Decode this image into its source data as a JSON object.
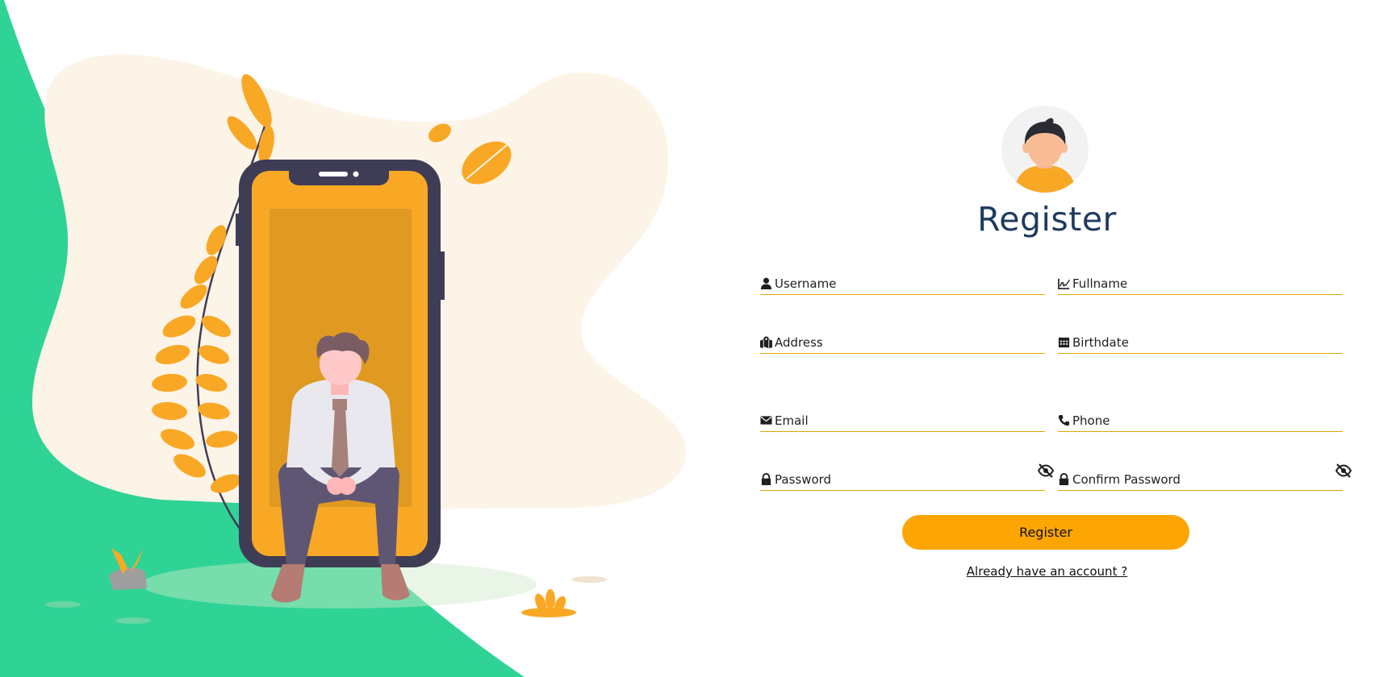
{
  "page": {
    "title": "Register",
    "accent_color": "#fca503",
    "wave_color": "#2fd396",
    "title_color": "#1e3a5f"
  },
  "form": {
    "fields": {
      "username": {
        "placeholder": "Username",
        "icon": "user-icon"
      },
      "fullname": {
        "placeholder": "Fullname",
        "icon": "signature-icon"
      },
      "address": {
        "placeholder": "Address",
        "icon": "map-location-icon"
      },
      "birthdate": {
        "placeholder": "Birthdate",
        "icon": "calendar-icon"
      },
      "email": {
        "placeholder": "Email",
        "icon": "envelope-icon"
      },
      "phone": {
        "placeholder": "Phone",
        "icon": "phone-icon"
      },
      "password": {
        "placeholder": "Password",
        "icon": "lock-icon",
        "toggle_icon": "eye-slash-icon"
      },
      "confirm_password": {
        "placeholder": "Confirm Password",
        "icon": "lock-icon",
        "toggle_icon": "eye-slash-icon"
      }
    },
    "submit_label": "Register",
    "login_link": "Already have an account ?"
  }
}
